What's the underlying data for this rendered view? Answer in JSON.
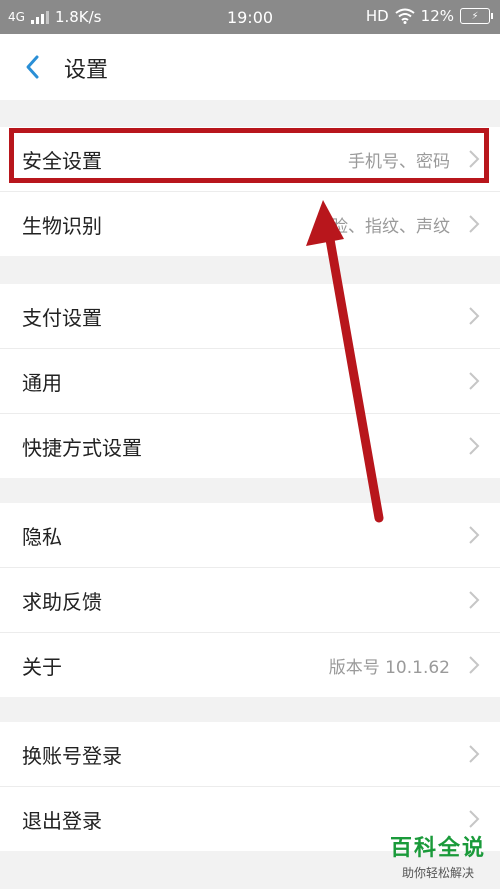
{
  "status_bar": {
    "network": "4G",
    "speed": "1.8K/s",
    "time": "19:00",
    "hd": "HD",
    "battery": "12%"
  },
  "header": {
    "title": "设置",
    "back_icon": "chevron-left-icon"
  },
  "groups": [
    {
      "items": [
        {
          "label": "安全设置",
          "value": "手机号、密码"
        },
        {
          "label": "生物识别",
          "value": "人脸、指纹、声纹"
        }
      ]
    },
    {
      "items": [
        {
          "label": "支付设置",
          "value": ""
        },
        {
          "label": "通用",
          "value": ""
        },
        {
          "label": "快捷方式设置",
          "value": ""
        }
      ]
    },
    {
      "items": [
        {
          "label": "隐私",
          "value": ""
        },
        {
          "label": "求助反馈",
          "value": ""
        },
        {
          "label": "关于",
          "value": "版本号 10.1.62"
        }
      ]
    },
    {
      "items": [
        {
          "label": "换账号登录",
          "value": ""
        },
        {
          "label": "退出登录",
          "value": ""
        }
      ]
    }
  ],
  "annotation": {
    "highlight_color": "#b8161c",
    "highlighted_item": "安全设置"
  },
  "watermark": {
    "title": "百科全说",
    "subtitle": "助你轻松解决"
  },
  "colors": {
    "accent": "#2a8fd6",
    "background": "#f2f2f2",
    "status_bar": "#8a8a8a"
  }
}
